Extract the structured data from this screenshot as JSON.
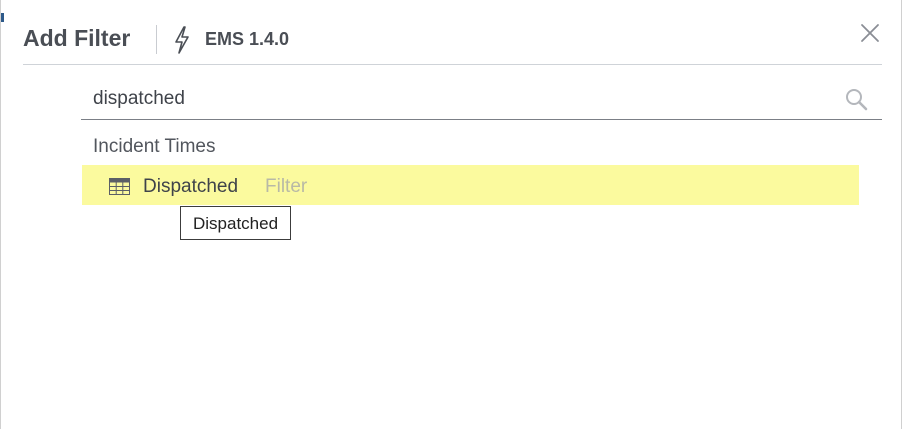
{
  "dialog": {
    "title": "Add Filter",
    "version": "EMS 1.4.0"
  },
  "search": {
    "value": "dispatched",
    "placeholder": ""
  },
  "results": {
    "group_label": "Incident Times",
    "items": [
      {
        "name": "Dispatched",
        "type": "Filter"
      }
    ]
  },
  "tooltip": {
    "text": "Dispatched"
  },
  "colors": {
    "highlight": "#fbfa9e",
    "text": "#4a4e55",
    "muted_type": "#b8b9a6"
  },
  "icons": [
    "lightning-bolt-icon",
    "close-icon",
    "search-icon",
    "table-icon"
  ]
}
